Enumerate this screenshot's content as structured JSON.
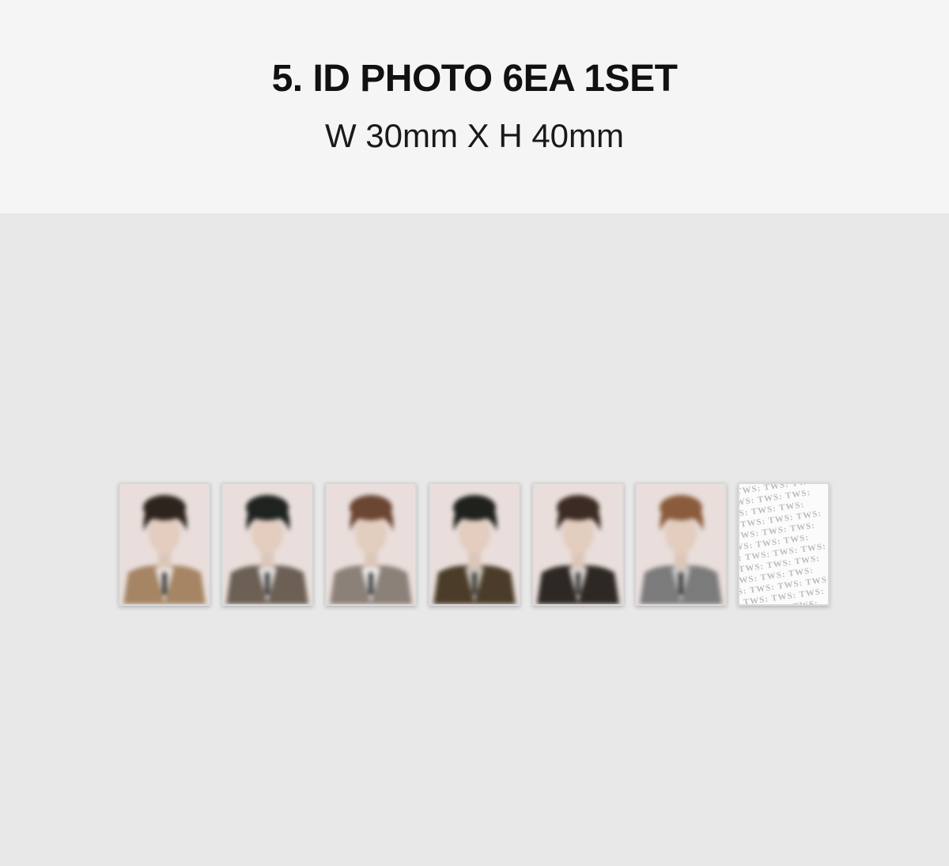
{
  "header": {
    "title": "5. ID PHOTO 6EA 1SET",
    "subtitle": "W 30mm X H 40mm"
  },
  "colors": {
    "header_bg": "#f5f5f5",
    "stage_bg": "#e8e8e8",
    "photo_bg": "#e9dedb"
  },
  "photos": [
    {
      "name": "id-photo-1",
      "hair": "#2e241e",
      "outfit": "#a58563",
      "inner": "#e9e2de"
    },
    {
      "name": "id-photo-2",
      "hair": "#1e2320",
      "outfit": "#6c6055",
      "inner": "#e3e2e2"
    },
    {
      "name": "id-photo-3",
      "hair": "#6b4632",
      "outfit": "#8c8178",
      "inner": "#efeeee"
    },
    {
      "name": "id-photo-4",
      "hair": "#1f211d",
      "outfit": "#4a3c28",
      "inner": "#c9c4ba"
    },
    {
      "name": "id-photo-5",
      "hair": "#3b2b22",
      "outfit": "#2d2823",
      "inner": "#d8d4d0"
    },
    {
      "name": "id-photo-6",
      "hair": "#8a5c3b",
      "outfit": "#7c7b7c",
      "inner": "#c8c8c8"
    }
  ],
  "card_back": {
    "logo_text": "TWS: TWS: TWS: TWS:"
  }
}
